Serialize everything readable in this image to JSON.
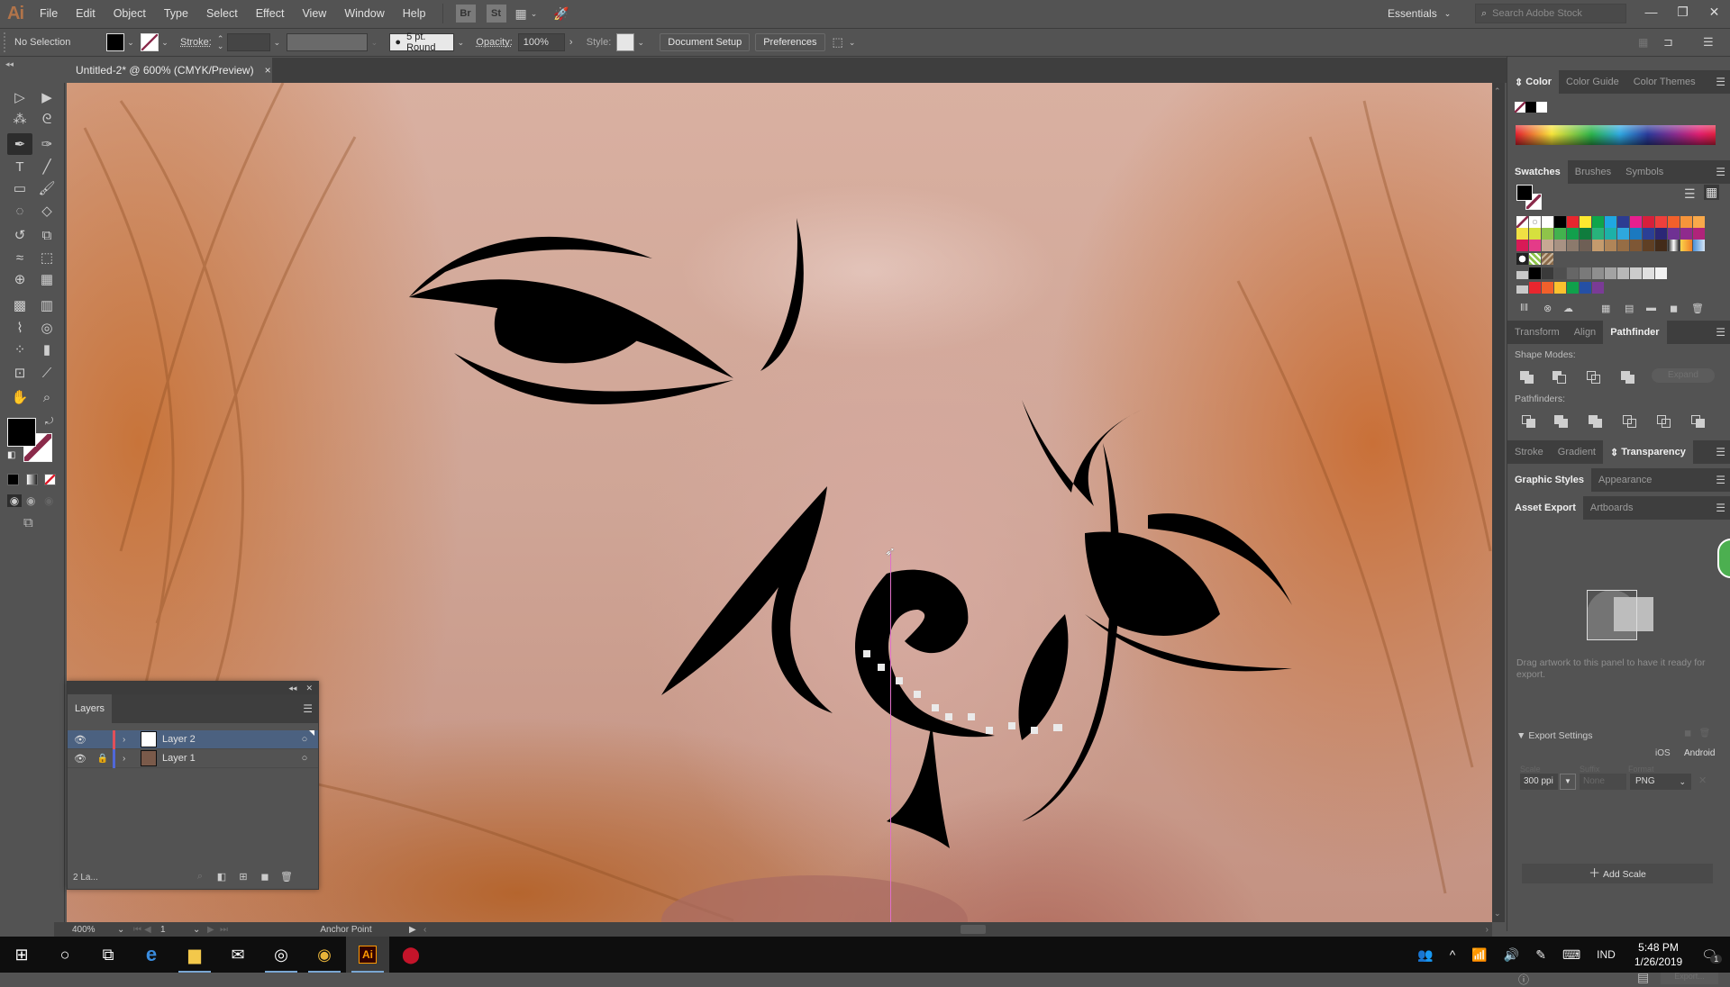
{
  "app": {
    "logo": "Ai",
    "menu": [
      "File",
      "Edit",
      "Object",
      "Type",
      "Select",
      "Effect",
      "View",
      "Window",
      "Help"
    ],
    "menubar_icons": [
      {
        "name": "bridge",
        "label": "Br"
      },
      {
        "name": "stock",
        "label": "St"
      }
    ],
    "workspace": "Essentials",
    "search_placeholder": "Search Adobe Stock",
    "window_controls": {
      "minimize": "—",
      "restore": "❐",
      "close": "✕"
    }
  },
  "control_bar": {
    "selection": "No Selection",
    "stroke_label": "Stroke:",
    "brush": "5 pt. Round",
    "opacity_label": "Opacity:",
    "opacity": "100%",
    "style_label": "Style:",
    "document_setup": "Document Setup",
    "preferences": "Preferences"
  },
  "document": {
    "tab_title": "Untitled-2* @ 600% (CMYK/Preview)",
    "close": "×"
  },
  "tools": [
    {
      "name": "selection-tool",
      "glyph": "▷"
    },
    {
      "name": "direct-selection-tool",
      "glyph": "▶"
    },
    {
      "name": "magic-wand-tool",
      "glyph": "⁂"
    },
    {
      "name": "lasso-tool",
      "glyph": "ᘓ"
    },
    {
      "name": "pen-tool",
      "glyph": "✒",
      "active": true
    },
    {
      "name": "curvature-tool",
      "glyph": "✑"
    },
    {
      "name": "type-tool",
      "glyph": "T"
    },
    {
      "name": "line-tool",
      "glyph": "╱"
    },
    {
      "name": "rectangle-tool",
      "glyph": "▭"
    },
    {
      "name": "paintbrush-tool",
      "glyph": "🖌"
    },
    {
      "name": "shaper-tool",
      "glyph": "◌"
    },
    {
      "name": "eraser-tool",
      "glyph": "◇"
    },
    {
      "name": "rotate-tool",
      "glyph": "↺"
    },
    {
      "name": "scale-tool",
      "glyph": "⧉"
    },
    {
      "name": "warp-tool",
      "glyph": "≈"
    },
    {
      "name": "free-transform-tool",
      "glyph": "⬚"
    },
    {
      "name": "shape-builder-tool",
      "glyph": "⊕"
    },
    {
      "name": "perspective-grid-tool",
      "glyph": "▦"
    },
    {
      "name": "mesh-tool",
      "glyph": "▩"
    },
    {
      "name": "gradient-tool",
      "glyph": "▥"
    },
    {
      "name": "eyedropper-tool",
      "glyph": "⌇"
    },
    {
      "name": "blend-tool",
      "glyph": "◎"
    },
    {
      "name": "symbol-sprayer-tool",
      "glyph": "⁘"
    },
    {
      "name": "column-graph-tool",
      "glyph": "▮"
    },
    {
      "name": "artboard-tool",
      "glyph": "⊡"
    },
    {
      "name": "slice-tool",
      "glyph": "⟋"
    },
    {
      "name": "hand-tool",
      "glyph": "✋"
    },
    {
      "name": "zoom-tool",
      "glyph": "⌕"
    }
  ],
  "fill_stroke": {
    "fill": "#000000",
    "stroke": "none"
  },
  "status_bar": {
    "zoom": "400%",
    "artboard": "1",
    "tool_status": "Anchor Point"
  },
  "layers_panel": {
    "title": "Layers",
    "layers": [
      {
        "name": "Layer 2",
        "visible": true,
        "locked": false,
        "color": "#e0505a",
        "selected": true
      },
      {
        "name": "Layer 1",
        "visible": true,
        "locked": true,
        "color": "#5068d8",
        "selected": false
      }
    ],
    "footer_count": "2 La..."
  },
  "color_panel": {
    "tabs": [
      "Color",
      "Color Guide",
      "Color Themes"
    ],
    "active_tab": "Color"
  },
  "swatches_panel": {
    "tabs": [
      "Swatches",
      "Brushes",
      "Symbols"
    ],
    "active_tab": "Swatches",
    "rows": [
      [
        "none",
        "reg",
        "#ffffff",
        "#000000",
        "#e8262e",
        "#fde92f",
        "#0ea54b",
        "#1fa7e1",
        "#2c3c91",
        "#e81f8f",
        "#d71f3b",
        "#ee3f3c",
        "#f1602b",
        "#f6943a",
        "#f9a94a"
      ],
      [
        "#f0e043",
        "#d6e03e",
        "#8fc44a",
        "#43b24e",
        "#12a04c",
        "#0f7c3d",
        "#28b37b",
        "#1db1a8",
        "#2ea8dd",
        "#1b79c0",
        "#2b3f95",
        "#2b2776",
        "#6f3193",
        "#8f2a8d",
        "#b0237a"
      ],
      [
        "#d81a56",
        "#e43b88",
        "#c7a893",
        "#a89283",
        "#8c7a6c",
        "#6e5f55",
        "#c49b6d",
        "#b08558",
        "#966d45",
        "#7e5735",
        "#5f3f24",
        "#432b19",
        "gradient-bw",
        "gradient-orange",
        "gradient-blue"
      ],
      [
        "pattern-1",
        "pattern-2",
        "pattern-3"
      ],
      [
        "folder",
        "#000000",
        "#3a3a3a",
        "#4f4f4f",
        "#666666",
        "#7a7a7a",
        "#8f8f8f",
        "#a3a3a3",
        "#b8b8b8",
        "#cccccc",
        "#e0e0e0",
        "#f2f2f2"
      ],
      [
        "folder",
        "#e8262e",
        "#f1602b",
        "#fbc12e",
        "#10a14b",
        "#2550a5",
        "#7a3b96"
      ]
    ]
  },
  "pathfinder_panel": {
    "tabs": [
      "Transform",
      "Align",
      "Pathfinder"
    ],
    "active_tab": "Pathfinder",
    "shape_modes_label": "Shape Modes:",
    "expand": "Expand",
    "pathfinders_label": "Pathfinders:"
  },
  "transparency_tabs": {
    "tabs": [
      "Stroke",
      "Gradient",
      "Transparency"
    ],
    "active_tab": "Transparency"
  },
  "graphic_styles_tabs": {
    "tabs": [
      "Graphic Styles",
      "Appearance"
    ],
    "active_tab": "Graphic Styles"
  },
  "asset_export_panel": {
    "tabs": [
      "Asset Export",
      "Artboards"
    ],
    "active_tab": "Asset Export",
    "hint": "Drag artwork to this panel to have it ready for export.",
    "export_settings": "Export Settings",
    "platforms": [
      "iOS",
      "Android"
    ],
    "col_scale": "Scale",
    "col_suffix": "Suffix",
    "col_format": "Format",
    "scale": "300 ppi",
    "suffix_placeholder": "None",
    "format": "PNG",
    "add_scale": "Add Scale",
    "export_button": "Export..."
  },
  "taskbar": {
    "apps": [
      "start",
      "cortana",
      "task-view",
      "edge",
      "file-explorer",
      "mail",
      "groove",
      "chrome",
      "illustrator",
      "acrobat-reader"
    ],
    "active_app": "illustrator",
    "language": "IND",
    "time": "5:48 PM",
    "date": "1/26/2019",
    "notifications": "1"
  }
}
